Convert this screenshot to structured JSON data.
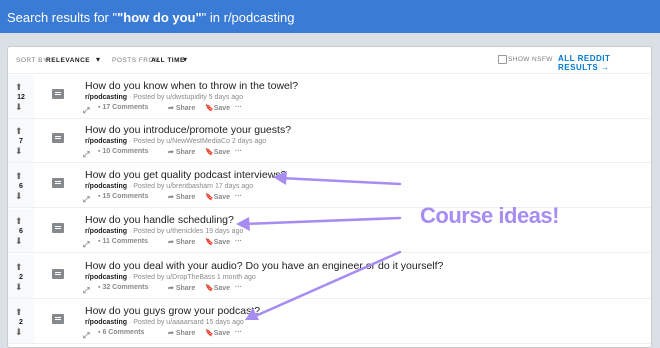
{
  "header": {
    "prefix": "Search results for \"",
    "query": "\"how do you\"",
    "suffix": "\" in r/podcasting"
  },
  "sortbar": {
    "sort_label": "SORT BY",
    "sort_value": "RELEVANCE",
    "posts_label": "POSTS FROM",
    "posts_value": "ALL TIME",
    "nsfw_label": "SHOW NSFW",
    "all_results": "ALL REDDIT RESULTS →"
  },
  "posts": [
    {
      "score": "12",
      "title": "How do you know when to throw in the towel?",
      "sub": "r/podcasting",
      "meta": " · Posted by u/dwstupidity 5 days ago",
      "comments": "17 Comments",
      "share": "Share",
      "save": "Save"
    },
    {
      "score": "7",
      "title": "How do you introduce/promote your guests?",
      "sub": "r/podcasting",
      "meta": " · Posted by u/NewWestMediaCo 2 days ago",
      "comments": "10 Comments",
      "share": "Share",
      "save": "Save"
    },
    {
      "score": "6",
      "title": "How do you get quality podcast interviews?",
      "sub": "r/podcasting",
      "meta": " · Posted by u/brentbasham 17 days ago",
      "comments": "15 Comments",
      "share": "Share",
      "save": "Save"
    },
    {
      "score": "6",
      "title": "How do you handle scheduling?",
      "sub": "r/podcasting",
      "meta": " · Posted by u/thenickles 19 days ago",
      "comments": "11 Comments",
      "share": "Share",
      "save": "Save"
    },
    {
      "score": "2",
      "title": "How do you deal with your audio? Do you have an engineer or do it yourself?",
      "sub": "r/podcasting",
      "meta": " · Posted by u/DropTheBass 1 month ago",
      "comments": "32 Comments",
      "share": "Share",
      "save": "Save"
    },
    {
      "score": "2",
      "title": "How do you guys grow your podcast?",
      "sub": "r/podcasting",
      "meta": " · Posted by u/aaaarsard 15 days ago",
      "comments": "6 Comments",
      "share": "Share",
      "save": "Save"
    }
  ],
  "annotation": "Course ideas!",
  "annotation_color": "#a78cf2",
  "header_color": "#3a7bd5"
}
